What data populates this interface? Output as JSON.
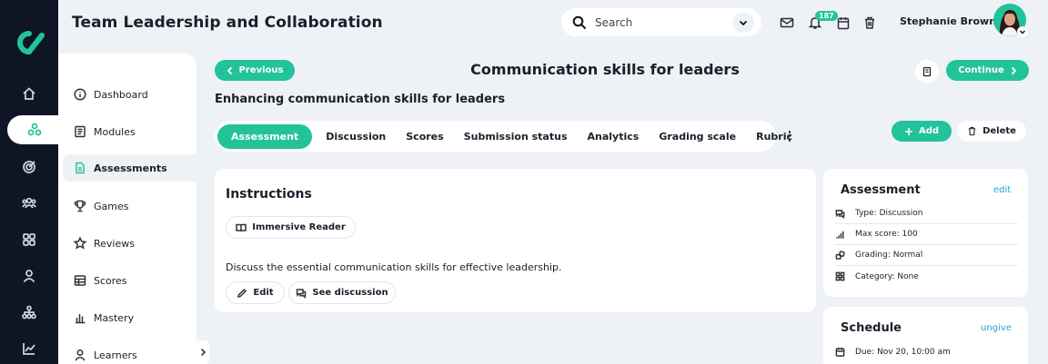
{
  "app": {
    "title": "Team Leadership and Collaboration"
  },
  "header": {
    "search_placeholder": "Search",
    "notifications_count": "187",
    "user_name": "Stephanie Brown"
  },
  "rail": [
    "home-icon",
    "network-icon",
    "target-icon",
    "people-icon",
    "grid-icon",
    "user-icon",
    "hierarchy-icon",
    "chart-icon"
  ],
  "sidebar": {
    "items": [
      {
        "label": "Dashboard",
        "icon": "info-icon"
      },
      {
        "label": "Modules",
        "icon": "book-icon"
      },
      {
        "label": "Assessments",
        "icon": "document-icon"
      },
      {
        "label": "Games",
        "icon": "trophy-icon"
      },
      {
        "label": "Reviews",
        "icon": "star-icon"
      },
      {
        "label": "Scores",
        "icon": "table-icon"
      },
      {
        "label": "Mastery",
        "icon": "bar-chart-icon"
      },
      {
        "label": "Learners",
        "icon": "person-icon"
      }
    ]
  },
  "page": {
    "prev_label": "Previous",
    "title": "Communication skills for leaders",
    "continue_label": "Continue",
    "subtitle": "Enhancing communication skills for leaders"
  },
  "tabs": [
    "Assessment",
    "Discussion",
    "Scores",
    "Submission status",
    "Analytics",
    "Grading scale",
    "Rubric"
  ],
  "actions": {
    "add_label": "Add",
    "delete_label": "Delete"
  },
  "instructions": {
    "heading": "Instructions",
    "reader_label": "Immersive Reader",
    "text": "Discuss the essential communication skills for effective leadership.",
    "edit_label": "Edit",
    "discussion_label": "See discussion"
  },
  "assessment": {
    "heading": "Assessment",
    "edit_link": "edit",
    "rows": [
      {
        "label": "Type: Discussion",
        "icon": "chat-icon"
      },
      {
        "label": "Max score: 100",
        "icon": "signal-icon"
      },
      {
        "label": "Grading: Normal",
        "icon": "dice-icon"
      },
      {
        "label": "Category: None",
        "icon": "category-icon"
      }
    ]
  },
  "schedule": {
    "heading": "Schedule",
    "ungive_link": "ungive",
    "due": "Due: Nov 20, 10:00 am"
  },
  "colors": {
    "accent": "#22c39a",
    "rail": "#0e1524",
    "background": "#eef1f6",
    "link": "#2a9fd6"
  }
}
